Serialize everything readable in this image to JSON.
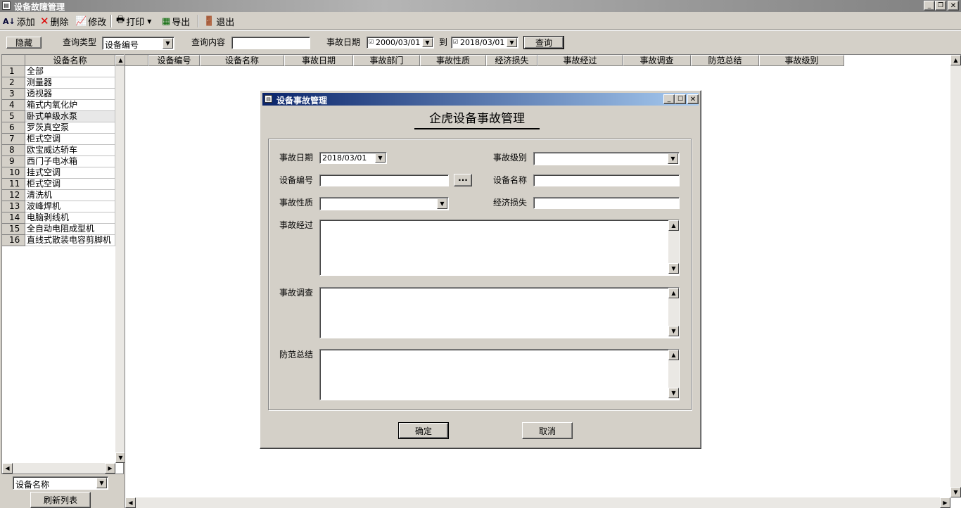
{
  "window": {
    "title": "设备故障管理"
  },
  "toolbar": {
    "add": "添加",
    "delete": "删除",
    "edit": "修改",
    "print": "打印",
    "export": "导出",
    "exit": "退出"
  },
  "query": {
    "hide_btn": "隐藏",
    "type_label": "查询类型",
    "type_value": "设备编号",
    "content_label": "查询内容",
    "content_value": "",
    "date_label": "事故日期",
    "date_from": "2000/03/01",
    "to_label": "到",
    "date_to": "2018/03/01",
    "query_btn": "查询"
  },
  "left": {
    "header": "设备名称",
    "items": [
      {
        "num": "1",
        "name": "全部"
      },
      {
        "num": "2",
        "name": "测量器"
      },
      {
        "num": "3",
        "name": "透视器"
      },
      {
        "num": "4",
        "name": "箱式内氧化炉"
      },
      {
        "num": "5",
        "name": "卧式单级水泵"
      },
      {
        "num": "6",
        "name": "罗茨真空泵"
      },
      {
        "num": "7",
        "name": "柜式空调"
      },
      {
        "num": "8",
        "name": "欧宝威达轿车"
      },
      {
        "num": "9",
        "name": "西门子电冰箱"
      },
      {
        "num": "10",
        "name": "挂式空调"
      },
      {
        "num": "11",
        "name": "柜式空调"
      },
      {
        "num": "12",
        "name": "清洗机"
      },
      {
        "num": "13",
        "name": "波峰焊机"
      },
      {
        "num": "14",
        "name": "电脑剥线机"
      },
      {
        "num": "15",
        "name": "全自动电阻成型机"
      },
      {
        "num": "16",
        "name": "直线式散装电容剪脚机"
      }
    ],
    "filter_value": "设备名称",
    "refresh_btn": "刷新列表"
  },
  "grid": {
    "columns": [
      "设备编号",
      "设备名称",
      "事故日期",
      "事故部门",
      "事故性质",
      "经济损失",
      "事故经过",
      "事故调查",
      "防范总结",
      "事故级别"
    ]
  },
  "dialog": {
    "title": "设备事故管理",
    "heading": "企虎设备事故管理",
    "date_label": "事故日期",
    "date_value": "2018/03/01",
    "level_label": "事故级别",
    "level_value": "",
    "code_label": "设备编号",
    "code_value": "",
    "browse_btn": "···",
    "name_label": "设备名称",
    "name_value": "",
    "nature_label": "事故性质",
    "nature_value": "",
    "loss_label": "经济损失",
    "loss_value": "",
    "process_label": "事故经过",
    "survey_label": "事故调查",
    "prevent_label": "防范总结",
    "ok_btn": "确定",
    "cancel_btn": "取消"
  }
}
